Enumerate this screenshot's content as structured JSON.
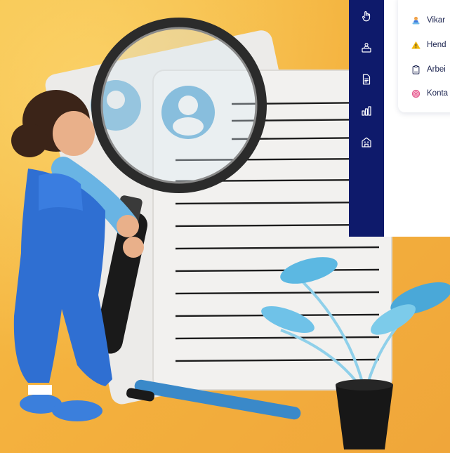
{
  "sidebar": {
    "icons": [
      "hand-pointer-icon",
      "user-desk-icon",
      "document-icon",
      "bar-chart-icon",
      "building-icon"
    ]
  },
  "menu": {
    "items": [
      {
        "label": "Vikar",
        "icon": "substitute-person-icon"
      },
      {
        "label": "Hend",
        "icon": "warning-icon"
      },
      {
        "label": "Arbei",
        "icon": "clipboard-icon"
      },
      {
        "label": "Konta",
        "icon": "contact-globe-icon"
      }
    ]
  },
  "colors": {
    "sidebar_bg": "#0e1a6b",
    "background": "#f4b23e",
    "warning": "#f2b705",
    "text": "#1c2450"
  }
}
